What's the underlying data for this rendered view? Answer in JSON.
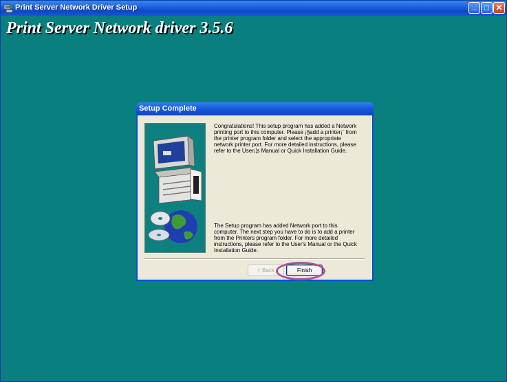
{
  "window": {
    "title": "Print Server Network Driver Setup",
    "controls": {
      "minimize": "_",
      "maximize": "□",
      "close": "✕"
    }
  },
  "banner": {
    "title": "Print Server Network driver 3.5.6"
  },
  "dialog": {
    "title": "Setup Complete",
    "message_top": "Congratulations! This setup program has added a Network printing port to this computer.  Please ¡§add a printer¡¨ from the printer program folder and select the appropriate network printer port.  For more detailed instructions, please refer to the User¡¦s Manual or Quick Installation Guide.",
    "message_bottom": "The Setup program has added Network port to this computer. The next step you have to do is to add a printer from the Printers program folder. For more detailed instructions, please refer to the User's Manual or the Quick Installation Guide.",
    "back_label": "< Back",
    "finish_label": "Finish",
    "illustration": "computer-globe-cd-icon"
  },
  "colors": {
    "desktop": "#0a7f7f",
    "titlebar": "#1d5fd8",
    "dialog_bg": "#ece9d8",
    "highlight": "#b0519a"
  }
}
